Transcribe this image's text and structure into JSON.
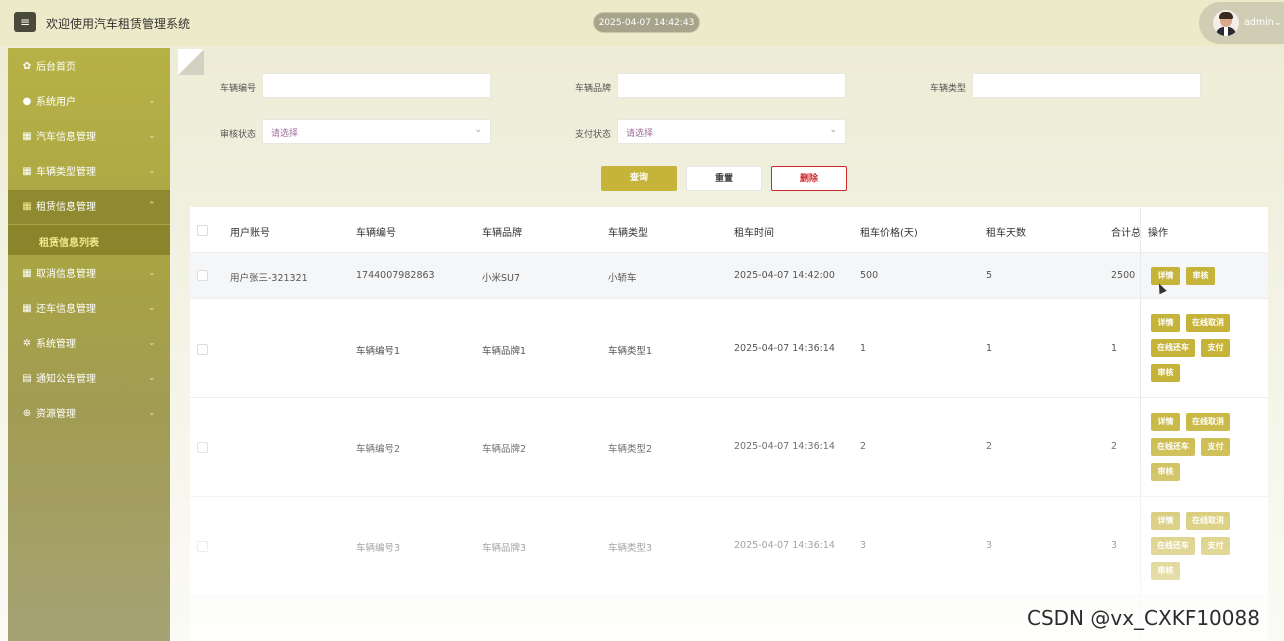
{
  "header": {
    "app_title": "欢迎使用汽车租赁管理系统",
    "datetime": "2025-04-07 14:42:43",
    "user": "admin"
  },
  "sidebar": {
    "items": [
      {
        "icon": "home-icon",
        "glyph": "✿",
        "label": "后台首页",
        "chev": ""
      },
      {
        "icon": "user-icon",
        "glyph": "👤",
        "label": "系统用户",
        "chev": "⌄"
      },
      {
        "icon": "grid-icon",
        "glyph": "▦",
        "label": "汽车信息管理",
        "chev": "⌄"
      },
      {
        "icon": "grid-icon",
        "glyph": "▦",
        "label": "车辆类型管理",
        "chev": "⌄"
      },
      {
        "icon": "grid-icon",
        "glyph": "▦",
        "label": "租赁信息管理",
        "chev": "⌃"
      },
      {
        "icon": "grid-icon",
        "glyph": "▦",
        "label": "取消信息管理",
        "chev": "⌄"
      },
      {
        "icon": "grid-icon",
        "glyph": "▦",
        "label": "还车信息管理",
        "chev": "⌄"
      },
      {
        "icon": "gear-icon",
        "glyph": "✲",
        "label": "系统管理",
        "chev": "⌄"
      },
      {
        "icon": "notice-icon",
        "glyph": "▤",
        "label": "通知公告管理",
        "chev": "⌄"
      },
      {
        "icon": "resource-icon",
        "glyph": "⊕",
        "label": "资源管理",
        "chev": "⌄"
      }
    ],
    "sub_item": "租赁信息列表"
  },
  "search": {
    "vehicle_no_label": "车辆编号",
    "brand_label": "车辆品牌",
    "type_label": "车辆类型",
    "audit_label": "审核状态",
    "audit_placeholder": "请选择",
    "pay_label": "支付状态",
    "pay_placeholder": "请选择",
    "query_btn": "查询",
    "reset_btn": "重置",
    "delete_btn": "删除"
  },
  "table": {
    "headers": [
      "用户账号",
      "车辆编号",
      "车辆品牌",
      "车辆类型",
      "租车时间",
      "租车价格(天)",
      "租车天数",
      "合计总",
      "操作"
    ],
    "rows": [
      {
        "user": "用户张三-321321",
        "no": "1744007982863",
        "brand": "小米SU7",
        "type": "小轿车",
        "time": "2025-04-07 14:42:00",
        "price": "500",
        "days": "5",
        "total": "2500"
      },
      {
        "user": "",
        "no": "车辆编号1",
        "brand": "车辆品牌1",
        "type": "车辆类型1",
        "time": "2025-04-07 14:36:14",
        "price": "1",
        "days": "1",
        "total": "1"
      },
      {
        "user": "",
        "no": "车辆编号2",
        "brand": "车辆品牌2",
        "type": "车辆类型2",
        "time": "2025-04-07 14:36:14",
        "price": "2",
        "days": "2",
        "total": "2"
      },
      {
        "user": "",
        "no": "车辆编号3",
        "brand": "车辆品牌3",
        "type": "车辆类型3",
        "time": "2025-04-07 14:36:14",
        "price": "3",
        "days": "3",
        "total": "3"
      }
    ],
    "actions": {
      "detail": "详情",
      "audit": "审核",
      "cancel": "在线取消",
      "return": "在线还车",
      "pay": "支付"
    }
  },
  "watermark": "CSDN @vx_CXKF10088"
}
